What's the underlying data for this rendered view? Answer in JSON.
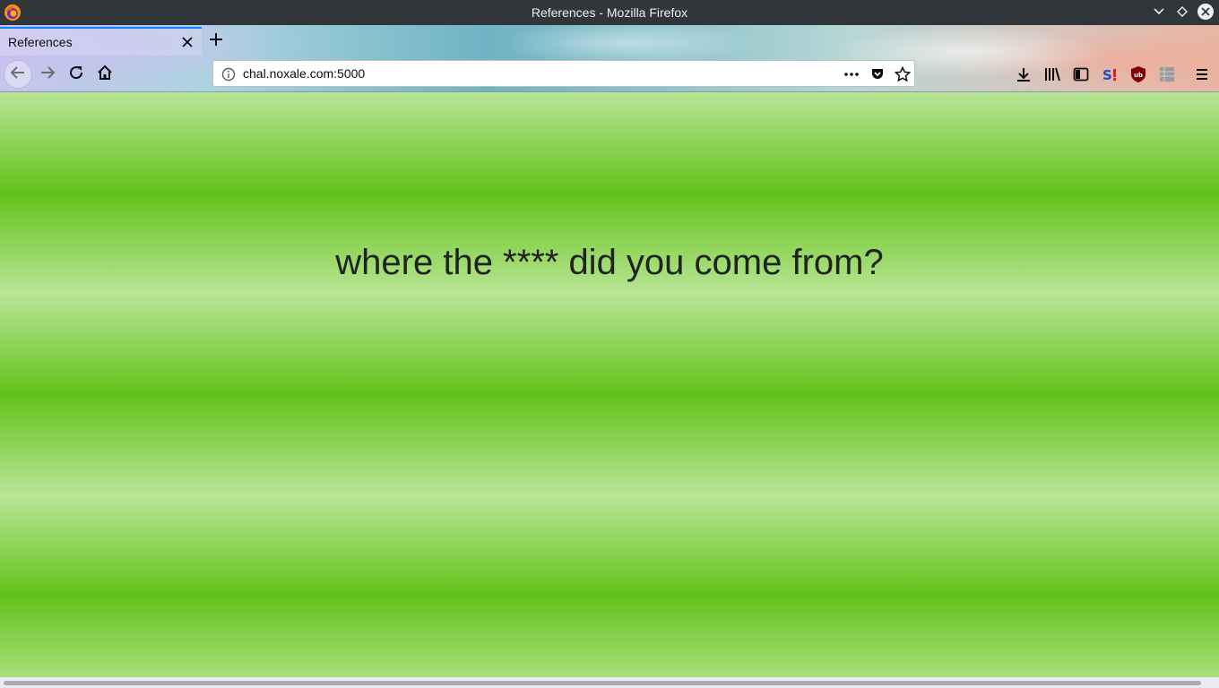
{
  "window": {
    "title": "References - Mozilla Firefox"
  },
  "tabs": [
    {
      "label": "References",
      "active": true
    }
  ],
  "navbar": {
    "url": "chal.noxale.com:5000"
  },
  "toolbar_icons": [
    "download-icon",
    "library-icon",
    "sidebar-icon",
    "extension-s-icon",
    "ublock-icon",
    "extension-grid-icon",
    "hamburger-menu-icon"
  ],
  "page": {
    "headline": "where the **** did you come from?"
  },
  "colors": {
    "accent": "#0a84ff",
    "page_green": "#63c21b",
    "page_light_green": "#b8e596"
  }
}
